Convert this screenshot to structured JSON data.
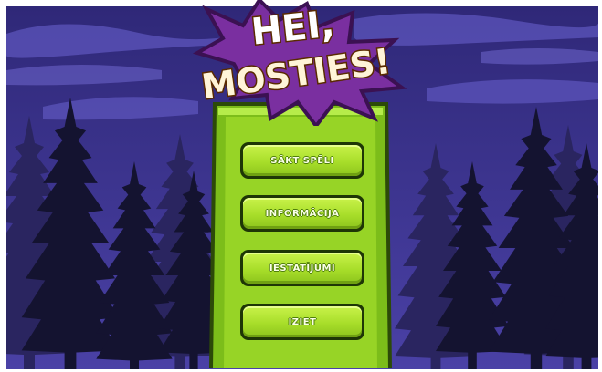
{
  "game": {
    "title_line1": "HEI,",
    "title_line2": "MOSTIES!"
  },
  "menu": {
    "items": [
      {
        "label": "SĀKT SPĒLI"
      },
      {
        "label": "INFORMĀCIJA"
      },
      {
        "label": "IESTATĪJUMI"
      },
      {
        "label": "IZIET"
      }
    ]
  },
  "colors": {
    "sky": "#3d3590",
    "panel_green": "#8ccd1e",
    "button_green": "#b4e636",
    "tree_dark": "#15142e",
    "starburst": "#7a2fa0"
  }
}
